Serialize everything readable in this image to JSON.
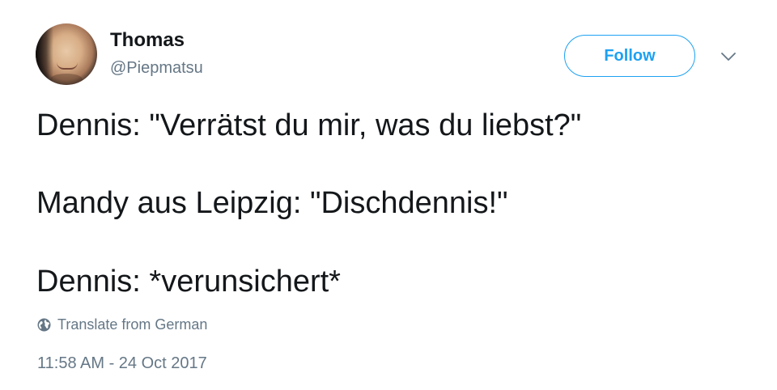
{
  "user": {
    "display_name": "Thomas",
    "handle": "@Piepmatsu"
  },
  "actions": {
    "follow_label": "Follow",
    "more_icon": "chevron-down-icon"
  },
  "tweet": {
    "lines": [
      "Dennis: \"Verrätst du mir, was du liebst?\"",
      "Mandy aus Leipzig: \"Dischdennis!\"",
      "Dennis: *verunsichert*"
    ],
    "translate_label": "Translate from German",
    "translate_icon": "globe-icon",
    "timestamp": "11:58 AM - 24 Oct 2017"
  },
  "colors": {
    "accent": "#1da1f2",
    "primary_text": "#14171a",
    "secondary_text": "#657786"
  }
}
